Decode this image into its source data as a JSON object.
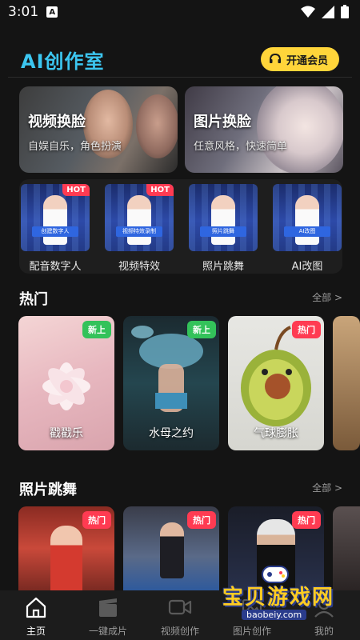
{
  "status_bar": {
    "time": "3:01",
    "a_icon": "A"
  },
  "header": {
    "title": "AI创作室",
    "vip_label": "开通会员"
  },
  "features": [
    {
      "title": "视频换脸",
      "subtitle": "自娱自乐，角色扮演"
    },
    {
      "title": "图片换脸",
      "subtitle": "任意风格，快速简单"
    }
  ],
  "tools": [
    {
      "label": "配音数字人",
      "badge": "HOT",
      "caption": "创建数字人"
    },
    {
      "label": "视频特效",
      "badge": "HOT",
      "caption": "视频特效录制"
    },
    {
      "label": "照片跳舞",
      "badge": "",
      "caption": "照片跳舞"
    },
    {
      "label": "AI改图",
      "badge": "",
      "caption": "AI改图"
    }
  ],
  "hot_section": {
    "title": "热门",
    "more": "全部 >",
    "cards": [
      {
        "label": "戳戳乐",
        "tag": "新上",
        "tag_type": "new"
      },
      {
        "label": "水母之约",
        "tag": "新上",
        "tag_type": "new"
      },
      {
        "label": "气球膨胀",
        "tag": "热门",
        "tag_type": "hot"
      }
    ]
  },
  "dance_section": {
    "title": "照片跳舞",
    "more": "全部 >",
    "cards": [
      {
        "tag": "热门"
      },
      {
        "tag": "热门"
      },
      {
        "tag": "热门"
      }
    ]
  },
  "bottom_nav": [
    {
      "label": "主页",
      "icon": "home-icon",
      "active": true
    },
    {
      "label": "一键成片",
      "icon": "clapperboard-icon",
      "active": false
    },
    {
      "label": "视频创作",
      "icon": "video-camera-icon",
      "active": false
    },
    {
      "label": "图片创作",
      "icon": "image-icon",
      "active": false
    },
    {
      "label": "我的",
      "icon": "profile-icon",
      "active": false
    }
  ],
  "watermark": {
    "text": "宝贝游戏网",
    "url": "baobeiy.com"
  },
  "colors": {
    "accent": "#3cc6f0",
    "vip": "#ffd53a",
    "hot": "#ff3b52",
    "new": "#33c25a",
    "background": "#141414"
  }
}
